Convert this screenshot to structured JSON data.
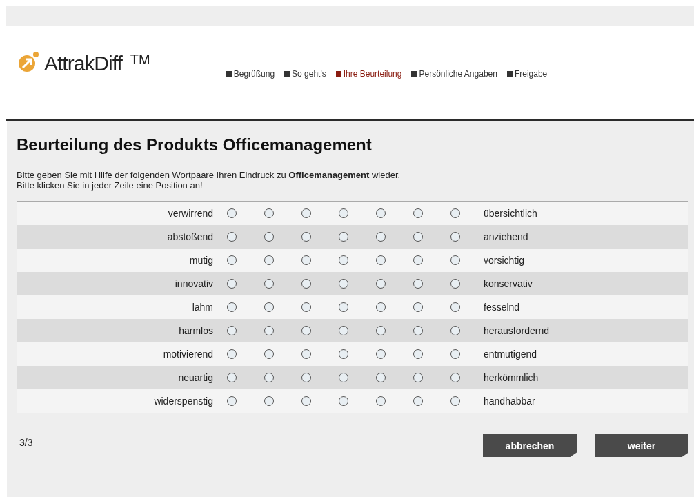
{
  "logo": {
    "name": "AttrakDiff",
    "mark": "TM"
  },
  "nav": [
    {
      "label": "Begrüßung",
      "selected": false
    },
    {
      "label": "So geht's",
      "selected": false
    },
    {
      "label": "Ihre Beurteilung",
      "selected": true
    },
    {
      "label": "Persönliche Angaben",
      "selected": false
    },
    {
      "label": "Freigabe",
      "selected": false
    }
  ],
  "title": "Beurteilung des Produkts Officemanagement",
  "intro": [
    "Bitte geben Sie mit Hilfe der folgenden Wortpaare Ihren Eindruck zu **Officemanagement** wieder.",
    "Bitte klicken Sie in jeder Zeile eine Position an!"
  ],
  "rows": [
    {
      "left": "verwirrend",
      "right": "übersichtlich",
      "options": [
        {
          "selected": false
        },
        {
          "selected": false
        },
        {
          "selected": false
        },
        {
          "selected": false
        },
        {
          "selected": false
        },
        {
          "selected": false
        },
        {
          "selected": false
        }
      ]
    },
    {
      "left": "abstoßend",
      "right": "anziehend",
      "options": [
        {
          "selected": false
        },
        {
          "selected": false
        },
        {
          "selected": false
        },
        {
          "selected": false
        },
        {
          "selected": false
        },
        {
          "selected": false
        },
        {
          "selected": false
        }
      ]
    },
    {
      "left": "mutig",
      "right": "vorsichtig",
      "options": [
        {
          "selected": false
        },
        {
          "selected": false
        },
        {
          "selected": false
        },
        {
          "selected": false
        },
        {
          "selected": false
        },
        {
          "selected": false
        },
        {
          "selected": false
        }
      ]
    },
    {
      "left": "innovativ",
      "right": "konservativ",
      "options": [
        {
          "selected": false
        },
        {
          "selected": false
        },
        {
          "selected": false
        },
        {
          "selected": false
        },
        {
          "selected": false
        },
        {
          "selected": false
        },
        {
          "selected": false
        }
      ]
    },
    {
      "left": "lahm",
      "right": "fesselnd",
      "options": [
        {
          "selected": false
        },
        {
          "selected": false
        },
        {
          "selected": false
        },
        {
          "selected": false
        },
        {
          "selected": false
        },
        {
          "selected": false
        },
        {
          "selected": false
        }
      ]
    },
    {
      "left": "harmlos",
      "right": "herausfordernd",
      "options": [
        {
          "selected": false
        },
        {
          "selected": false
        },
        {
          "selected": false
        },
        {
          "selected": false
        },
        {
          "selected": false
        },
        {
          "selected": false
        },
        {
          "selected": false
        }
      ]
    },
    {
      "left": "motivierend",
      "right": "entmutigend",
      "options": [
        {
          "selected": false
        },
        {
          "selected": false
        },
        {
          "selected": false
        },
        {
          "selected": false
        },
        {
          "selected": false
        },
        {
          "selected": false
        },
        {
          "selected": false
        }
      ]
    },
    {
      "left": "neuartig",
      "right": "herkömmlich",
      "options": [
        {
          "selected": false
        },
        {
          "selected": false
        },
        {
          "selected": false
        },
        {
          "selected": false
        },
        {
          "selected": false
        },
        {
          "selected": false
        },
        {
          "selected": false
        }
      ]
    },
    {
      "left": "widerspenstig",
      "right": "handhabbar",
      "options": [
        {
          "selected": false
        },
        {
          "selected": false
        },
        {
          "selected": false
        },
        {
          "selected": false
        },
        {
          "selected": false
        },
        {
          "selected": false
        },
        {
          "selected": false
        }
      ]
    }
  ],
  "page": "3/3",
  "buttons": [
    "abbrechen",
    "weiter"
  ]
}
